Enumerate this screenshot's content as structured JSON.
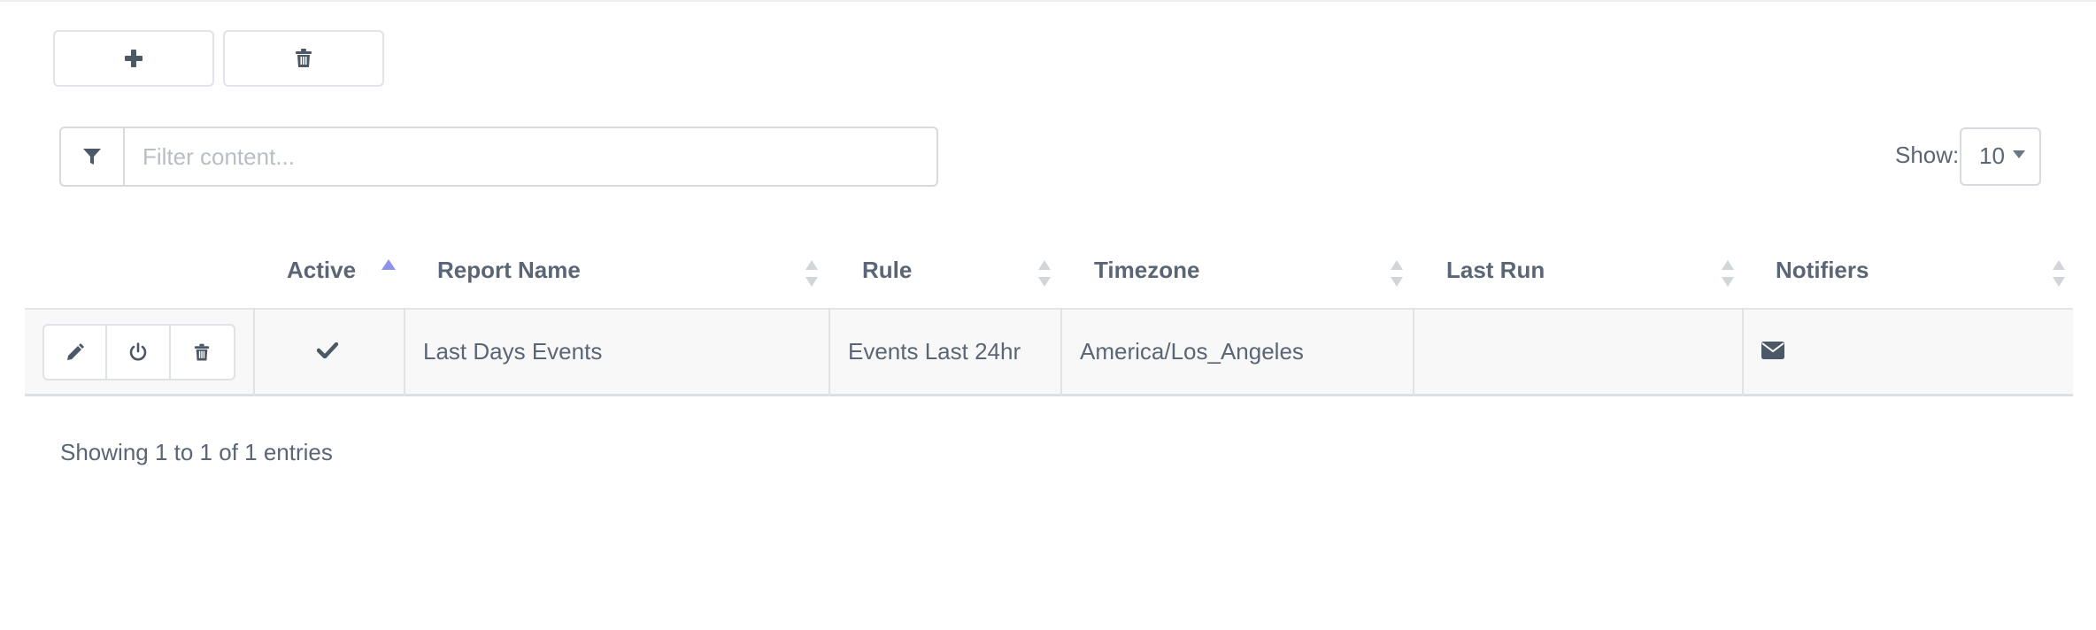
{
  "toolbar": {
    "add_icon": "plus-icon",
    "delete_icon": "trash-icon"
  },
  "filter": {
    "icon": "filter-icon",
    "placeholder": "Filter content...",
    "value": ""
  },
  "page_size": {
    "label": "Show:",
    "selected": "10"
  },
  "table": {
    "columns": [
      {
        "label": "Active",
        "sort": "ascending"
      },
      {
        "label": "Report Name",
        "sort": "none"
      },
      {
        "label": "Rule",
        "sort": "none"
      },
      {
        "label": "Timezone",
        "sort": "none"
      },
      {
        "label": "Last Run",
        "sort": "none"
      },
      {
        "label": "Notifiers",
        "sort": "none"
      }
    ],
    "rows": [
      {
        "actions": [
          "edit-icon",
          "power-icon",
          "trash-icon"
        ],
        "active_icon": "check-icon",
        "report_name": "Last Days Events",
        "rule": "Events Last 24hr",
        "timezone": "America/Los_Angeles",
        "last_run": "",
        "notifier_icon": "envelope-icon"
      }
    ]
  },
  "footer": {
    "info": "Showing 1 to 1 of 1 entries"
  },
  "colors": {
    "text": "#5a6675",
    "sort_active": "#8e92e8",
    "sort_inactive": "#d2d6db",
    "row_bg": "#f8f8f8",
    "border": "#dfe2e6"
  }
}
